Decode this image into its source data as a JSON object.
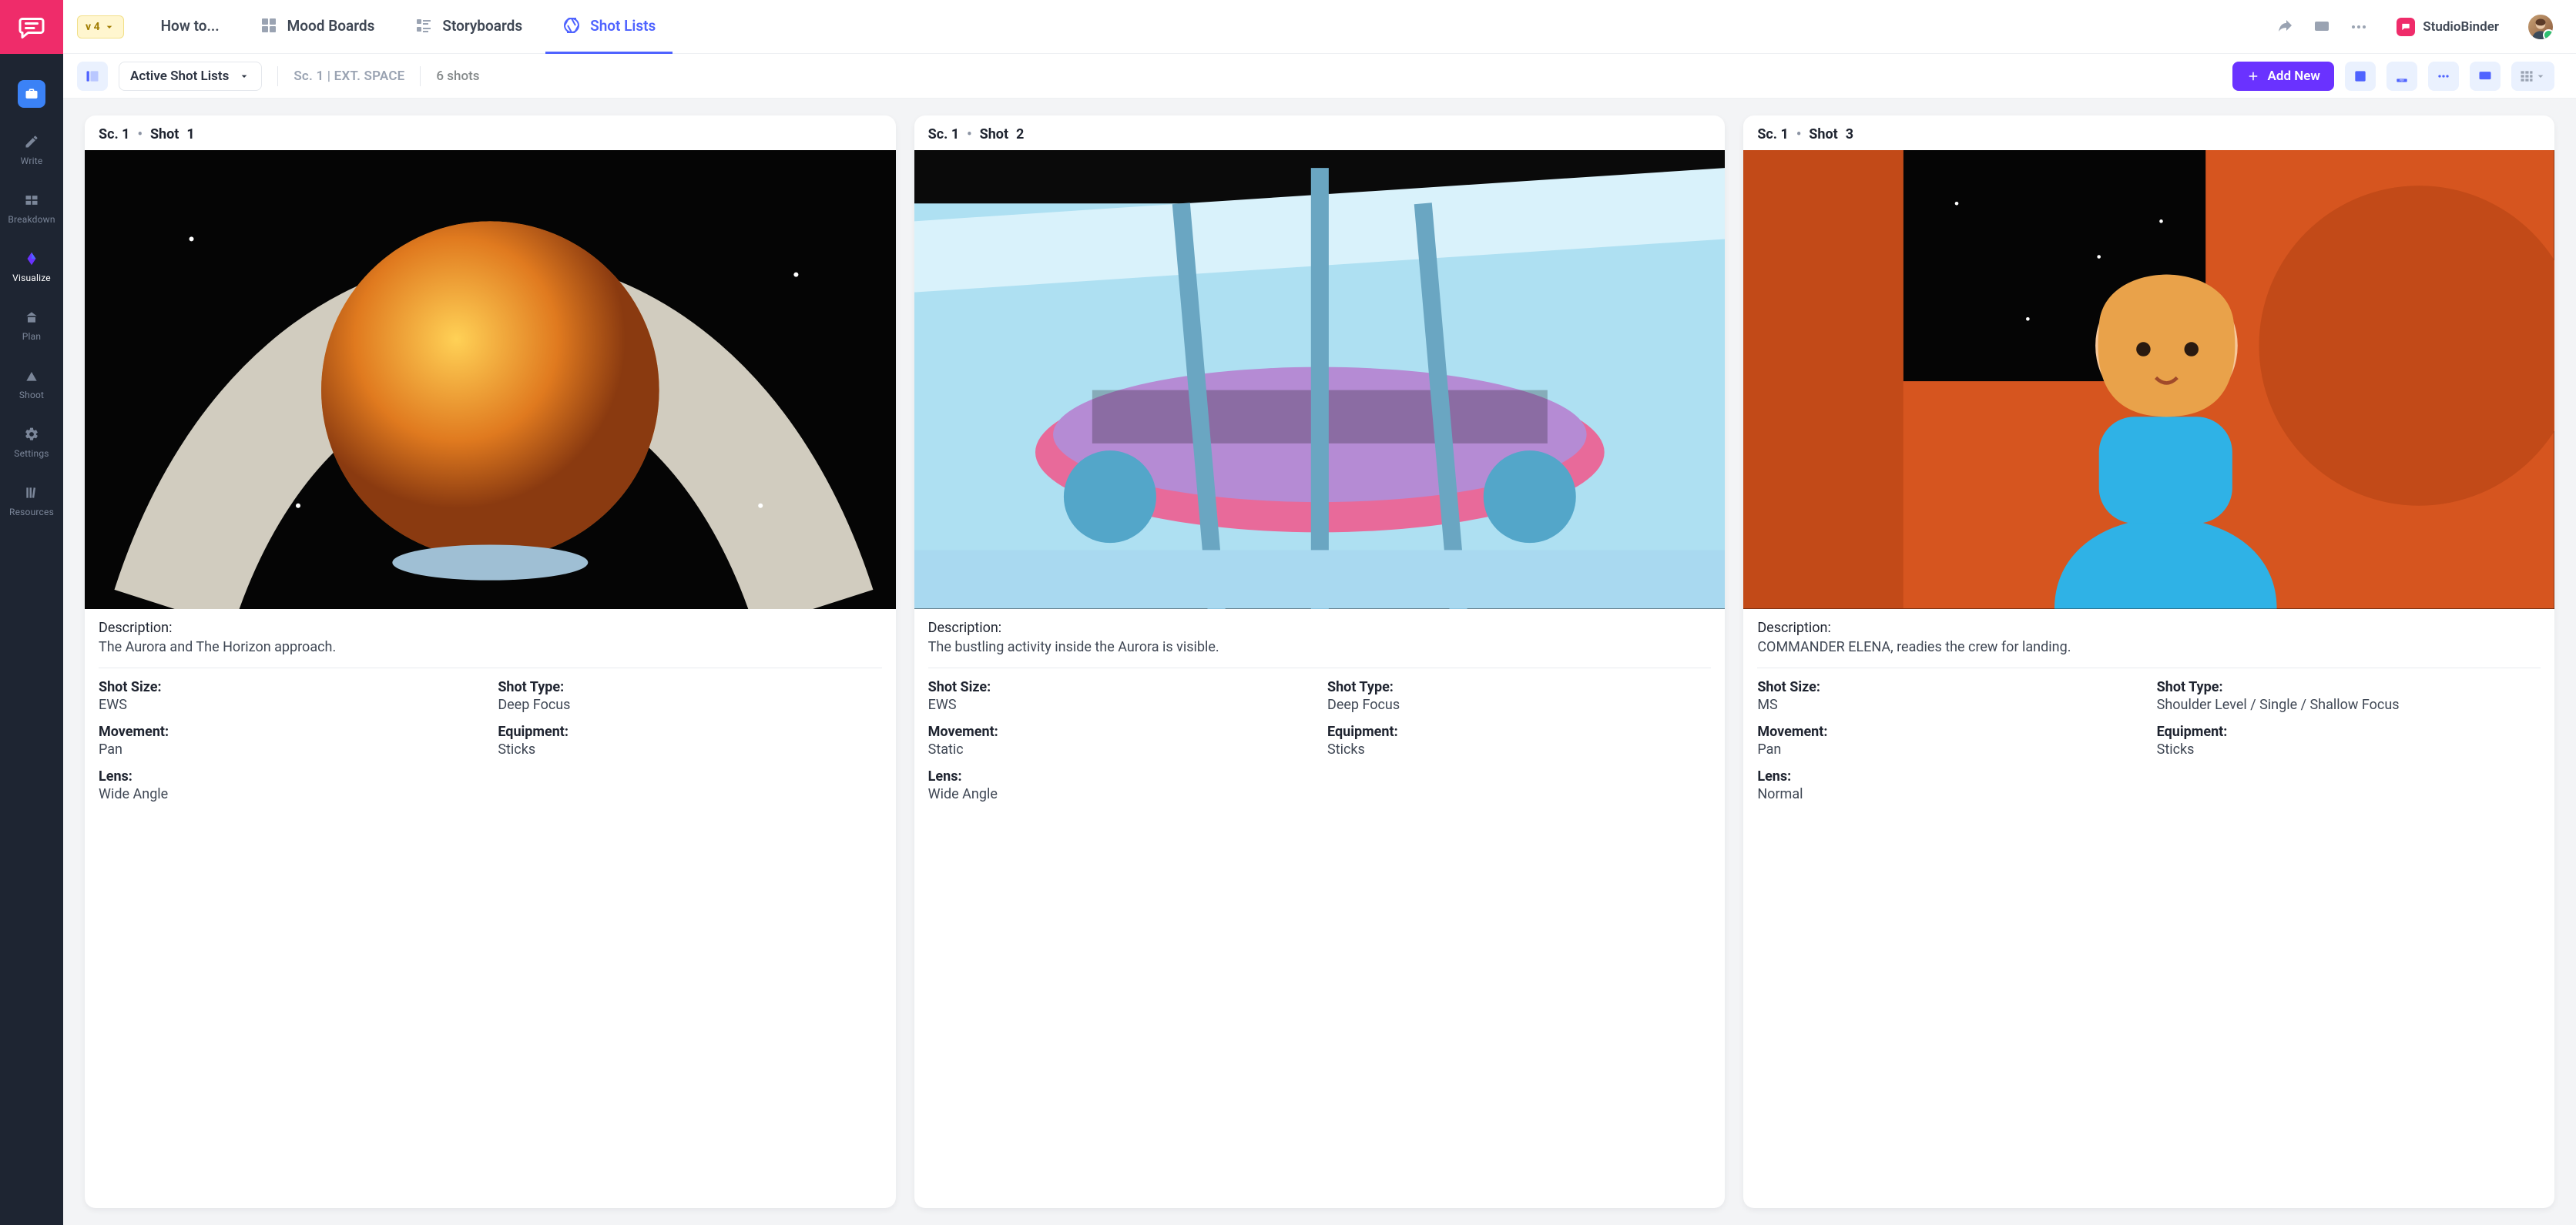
{
  "rail": {
    "items": [
      {
        "label": ""
      },
      {
        "label": "Write"
      },
      {
        "label": "Breakdown"
      },
      {
        "label": "Visualize"
      },
      {
        "label": "Plan"
      },
      {
        "label": "Shoot"
      },
      {
        "label": "Settings"
      },
      {
        "label": "Resources"
      }
    ]
  },
  "topbar": {
    "brand": "StudioBinder",
    "version": "v 4",
    "tabs": [
      {
        "label": "How to..."
      },
      {
        "label": "Mood Boards"
      },
      {
        "label": "Storyboards"
      },
      {
        "label": "Shot Lists"
      }
    ]
  },
  "filter": {
    "active_list": "Active Shot Lists",
    "scene": "Sc. 1 | EXT. SPACE",
    "count": "6 shots",
    "add_new": "Add New"
  },
  "labels": {
    "description": "Description:",
    "shot_size": "Shot Size:",
    "shot_type": "Shot Type:",
    "movement": "Movement:",
    "equipment": "Equipment:",
    "lens": "Lens:",
    "scene_prefix": "Sc. 1",
    "dot": "•",
    "shot_word": "Shot"
  },
  "shots": [
    {
      "number": "1",
      "description": "The Aurora and The Horizon approach.",
      "shot_size": "EWS",
      "shot_type": "Deep Focus",
      "movement": "Pan",
      "equipment": "Sticks",
      "lens": "Wide Angle"
    },
    {
      "number": "2",
      "description": "The bustling activity inside the Aurora is visible.",
      "shot_size": "EWS",
      "shot_type": "Deep Focus",
      "movement": "Static",
      "equipment": "Sticks",
      "lens": "Wide Angle"
    },
    {
      "number": "3",
      "description": "COMMANDER ELENA, readies the crew for landing.",
      "shot_size": "MS",
      "shot_type": "Shoulder Level / Single / Shallow Focus",
      "movement": "Pan",
      "equipment": "Sticks",
      "lens": "Normal"
    }
  ],
  "colors": {
    "accent_pink": "#ef2c6a",
    "accent_blue": "#4f63ff",
    "accent_purple": "#6a32ff"
  }
}
